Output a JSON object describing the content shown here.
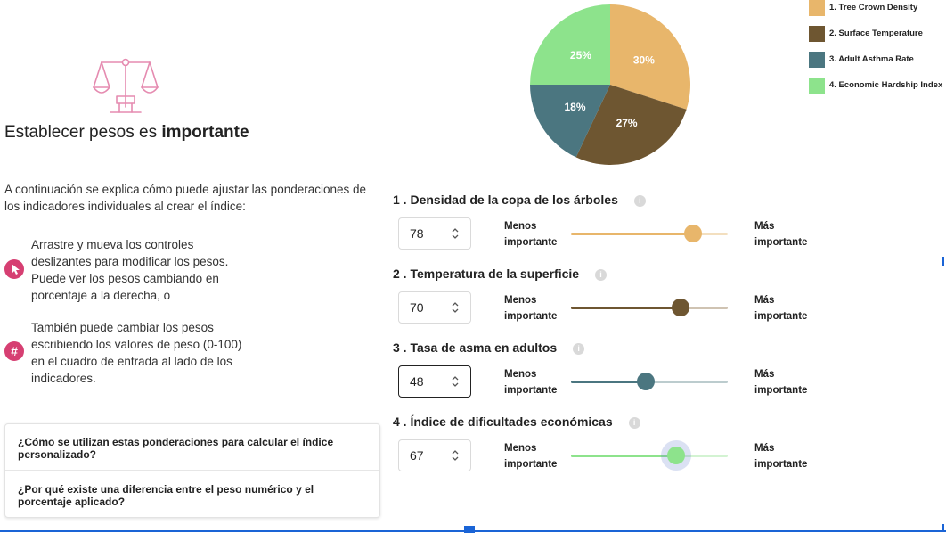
{
  "intro": {
    "title_prefix": "Establecer pesos es ",
    "title_emphasis": "importante",
    "description": "A continuación se explica cómo puede ajustar las ponderaciones de los indicadores individuales al crear el índice:",
    "tips": [
      {
        "icon": "cursor-icon",
        "text": "Arrastre y mueva los controles deslizantes para modificar los pesos. Puede ver los pesos cambiando en porcentaje a la derecha, o"
      },
      {
        "icon": "hash-icon",
        "symbol": "#",
        "text": "También puede cambiar los pesos escribiendo los valores de peso (0-100) en el cuadro de entrada al lado de los indicadores."
      }
    ]
  },
  "faq": [
    {
      "question": "¿Cómo se utilizan estas ponderaciones para calcular el índice personalizado?"
    },
    {
      "question": "¿Por qué existe una diferencia entre el peso numérico y el porcentaje aplicado?"
    }
  ],
  "chart_data": {
    "type": "pie",
    "labels": [
      "1. Tree Crown Density",
      "2. Surface Temperature",
      "3. Adult Asthma Rate",
      "4. Economic Hardship Index"
    ],
    "values": [
      30,
      27,
      18,
      25
    ],
    "value_labels": [
      "30%",
      "27%",
      "18%",
      "25%"
    ],
    "colors": [
      "#e8b66b",
      "#6e5631",
      "#4b7680",
      "#8de38c"
    ],
    "legend_position": "right"
  },
  "indicators": [
    {
      "title": "1 . Densidad de la copa de los árboles",
      "value": "78",
      "weight": 78,
      "color": "#e8b66b",
      "track": "#f3dfbf",
      "focused": false,
      "hover": false
    },
    {
      "title": "2 . Temperatura de la superficie",
      "value": "70",
      "weight": 70,
      "color": "#6e5631",
      "track": "#cfc3b2",
      "focused": false,
      "hover": false
    },
    {
      "title": "3 . Tasa de asma en adultos",
      "value": "48",
      "weight": 48,
      "color": "#4b7680",
      "track": "#bcccce",
      "focused": true,
      "hover": false
    },
    {
      "title": "4 . Índice de dificultades económicas",
      "value": "67",
      "weight": 67,
      "color": "#8de38c",
      "track": "#d3f3d2",
      "focused": false,
      "hover": true
    }
  ],
  "labels": {
    "less_line1": "Menos",
    "less_line2": "importante",
    "more_line1": "Más",
    "more_line2": "importante",
    "info_symbol": "i"
  },
  "colors": {
    "accent": "#d63f72",
    "scale_icon": "#e58bb0",
    "selection_blue": "#1a64d6"
  }
}
